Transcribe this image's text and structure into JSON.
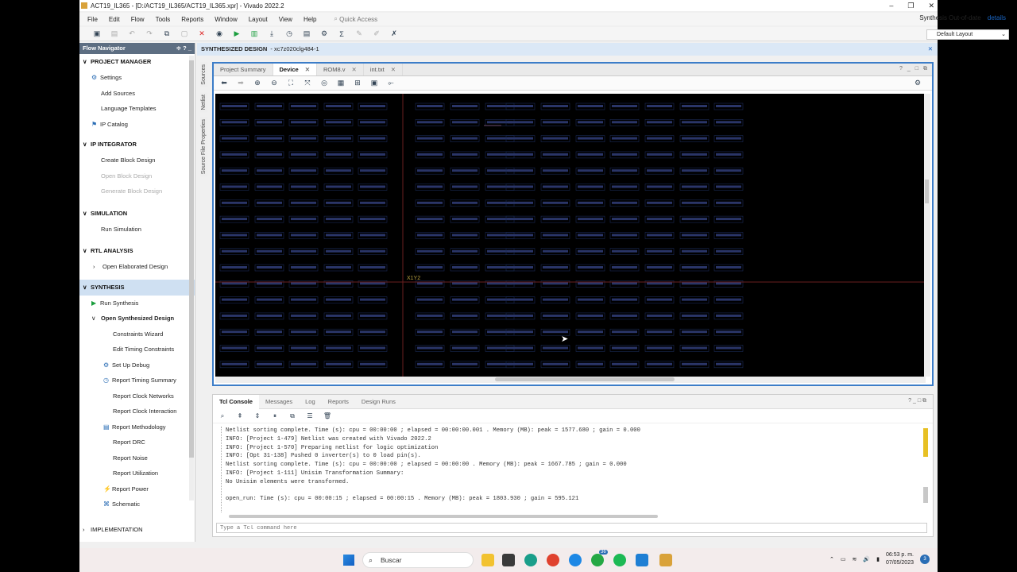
{
  "window": {
    "title": "ACT19_IL365 - [D:/ACT19_IL365/ACT19_IL365.xpr] - Vivado 2022.2",
    "minimize": "–",
    "restore": "❐",
    "close": "✕"
  },
  "menu": [
    "File",
    "Edit",
    "Flow",
    "Tools",
    "Reports",
    "Window",
    "Layout",
    "View",
    "Help"
  ],
  "quick_access_placeholder": "Quick Access",
  "status": {
    "text": "Synthesis Out-of-date",
    "link": "details"
  },
  "layout_select": "Default Layout",
  "flow_navigator": {
    "title": "Flow Navigator",
    "sections": [
      {
        "label": "PROJECT MANAGER",
        "items": [
          {
            "label": "Settings",
            "icon": "gear-icon"
          },
          {
            "label": "Add Sources"
          },
          {
            "label": "Language Templates"
          },
          {
            "label": "IP Catalog",
            "icon": "ip-icon"
          }
        ]
      },
      {
        "label": "IP INTEGRATOR",
        "items": [
          {
            "label": "Create Block Design"
          },
          {
            "label": "Open Block Design",
            "disabled": true
          },
          {
            "label": "Generate Block Design",
            "disabled": true
          }
        ]
      },
      {
        "label": "SIMULATION",
        "items": [
          {
            "label": "Run Simulation"
          }
        ]
      },
      {
        "label": "RTL ANALYSIS",
        "items": [
          {
            "label": "Open Elaborated Design"
          }
        ]
      },
      {
        "label": "SYNTHESIS",
        "items": [
          {
            "label": "Run Synthesis"
          },
          {
            "label": "Open Synthesized Design"
          },
          {
            "label": "Constraints Wizard"
          },
          {
            "label": "Edit Timing Constraints"
          },
          {
            "label": "Set Up Debug"
          },
          {
            "label": "Report Timing Summary"
          },
          {
            "label": "Report Clock Networks"
          },
          {
            "label": "Report Clock Interaction"
          },
          {
            "label": "Report Methodology"
          },
          {
            "label": "Report DRC"
          },
          {
            "label": "Report Noise"
          },
          {
            "label": "Report Utilization"
          },
          {
            "label": "Report Power"
          },
          {
            "label": "Schematic"
          }
        ]
      },
      {
        "label": "IMPLEMENTATION",
        "items": []
      }
    ]
  },
  "main_header": {
    "title": "SYNTHESIZED DESIGN",
    "part": "- xc7z020clg484-1"
  },
  "side_tabs": [
    "Sources",
    "Netlist",
    "Source File Properties"
  ],
  "device_tabs": [
    "Project Summary",
    "Device",
    "ROM8.v",
    "int.txt"
  ],
  "device_region_label": "X1Y2",
  "tcl": {
    "tabs": [
      "Tcl Console",
      "Messages",
      "Log",
      "Reports",
      "Design Runs"
    ],
    "lines": [
      "Netlist sorting complete. Time (s): cpu = 00:00:00 ; elapsed = 00:00:00.001 . Memory (MB): peak = 1577.680 ; gain = 0.000",
      "INFO: [Project 1-479] Netlist was created with Vivado 2022.2",
      "INFO: [Project 1-570] Preparing netlist for logic optimization",
      "INFO: [Opt 31-138] Pushed 0 inverter(s) to 0 load pin(s).",
      "Netlist sorting complete. Time (s): cpu = 00:00:00 ; elapsed = 00:00:00 . Memory (MB): peak = 1667.785 ; gain = 0.000",
      "INFO: [Project 1-111] Unisim Transformation Summary:",
      "No Unisim elements were transformed.",
      "",
      "open_run: Time (s): cpu = 00:00:15 ; elapsed = 00:00:15 . Memory (MB): peak = 1803.930 ; gain = 595.121"
    ],
    "input_placeholder": "Type a Tcl command here"
  },
  "taskbar": {
    "search": "Buscar",
    "time": "06:53 p. m.",
    "date": "07/05/2023",
    "notifications": "3",
    "badge": "36"
  }
}
